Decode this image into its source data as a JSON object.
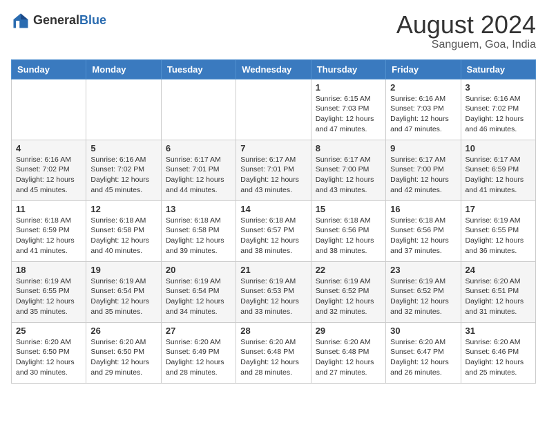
{
  "header": {
    "logo_general": "General",
    "logo_blue": "Blue",
    "month": "August 2024",
    "location": "Sanguem, Goa, India"
  },
  "weekdays": [
    "Sunday",
    "Monday",
    "Tuesday",
    "Wednesday",
    "Thursday",
    "Friday",
    "Saturday"
  ],
  "weeks": [
    [
      {
        "day": "",
        "info": ""
      },
      {
        "day": "",
        "info": ""
      },
      {
        "day": "",
        "info": ""
      },
      {
        "day": "",
        "info": ""
      },
      {
        "day": "1",
        "info": "Sunrise: 6:15 AM\nSunset: 7:03 PM\nDaylight: 12 hours\nand 47 minutes."
      },
      {
        "day": "2",
        "info": "Sunrise: 6:16 AM\nSunset: 7:03 PM\nDaylight: 12 hours\nand 47 minutes."
      },
      {
        "day": "3",
        "info": "Sunrise: 6:16 AM\nSunset: 7:02 PM\nDaylight: 12 hours\nand 46 minutes."
      }
    ],
    [
      {
        "day": "4",
        "info": "Sunrise: 6:16 AM\nSunset: 7:02 PM\nDaylight: 12 hours\nand 45 minutes."
      },
      {
        "day": "5",
        "info": "Sunrise: 6:16 AM\nSunset: 7:02 PM\nDaylight: 12 hours\nand 45 minutes."
      },
      {
        "day": "6",
        "info": "Sunrise: 6:17 AM\nSunset: 7:01 PM\nDaylight: 12 hours\nand 44 minutes."
      },
      {
        "day": "7",
        "info": "Sunrise: 6:17 AM\nSunset: 7:01 PM\nDaylight: 12 hours\nand 43 minutes."
      },
      {
        "day": "8",
        "info": "Sunrise: 6:17 AM\nSunset: 7:00 PM\nDaylight: 12 hours\nand 43 minutes."
      },
      {
        "day": "9",
        "info": "Sunrise: 6:17 AM\nSunset: 7:00 PM\nDaylight: 12 hours\nand 42 minutes."
      },
      {
        "day": "10",
        "info": "Sunrise: 6:17 AM\nSunset: 6:59 PM\nDaylight: 12 hours\nand 41 minutes."
      }
    ],
    [
      {
        "day": "11",
        "info": "Sunrise: 6:18 AM\nSunset: 6:59 PM\nDaylight: 12 hours\nand 41 minutes."
      },
      {
        "day": "12",
        "info": "Sunrise: 6:18 AM\nSunset: 6:58 PM\nDaylight: 12 hours\nand 40 minutes."
      },
      {
        "day": "13",
        "info": "Sunrise: 6:18 AM\nSunset: 6:58 PM\nDaylight: 12 hours\nand 39 minutes."
      },
      {
        "day": "14",
        "info": "Sunrise: 6:18 AM\nSunset: 6:57 PM\nDaylight: 12 hours\nand 38 minutes."
      },
      {
        "day": "15",
        "info": "Sunrise: 6:18 AM\nSunset: 6:56 PM\nDaylight: 12 hours\nand 38 minutes."
      },
      {
        "day": "16",
        "info": "Sunrise: 6:18 AM\nSunset: 6:56 PM\nDaylight: 12 hours\nand 37 minutes."
      },
      {
        "day": "17",
        "info": "Sunrise: 6:19 AM\nSunset: 6:55 PM\nDaylight: 12 hours\nand 36 minutes."
      }
    ],
    [
      {
        "day": "18",
        "info": "Sunrise: 6:19 AM\nSunset: 6:55 PM\nDaylight: 12 hours\nand 35 minutes."
      },
      {
        "day": "19",
        "info": "Sunrise: 6:19 AM\nSunset: 6:54 PM\nDaylight: 12 hours\nand 35 minutes."
      },
      {
        "day": "20",
        "info": "Sunrise: 6:19 AM\nSunset: 6:54 PM\nDaylight: 12 hours\nand 34 minutes."
      },
      {
        "day": "21",
        "info": "Sunrise: 6:19 AM\nSunset: 6:53 PM\nDaylight: 12 hours\nand 33 minutes."
      },
      {
        "day": "22",
        "info": "Sunrise: 6:19 AM\nSunset: 6:52 PM\nDaylight: 12 hours\nand 32 minutes."
      },
      {
        "day": "23",
        "info": "Sunrise: 6:19 AM\nSunset: 6:52 PM\nDaylight: 12 hours\nand 32 minutes."
      },
      {
        "day": "24",
        "info": "Sunrise: 6:20 AM\nSunset: 6:51 PM\nDaylight: 12 hours\nand 31 minutes."
      }
    ],
    [
      {
        "day": "25",
        "info": "Sunrise: 6:20 AM\nSunset: 6:50 PM\nDaylight: 12 hours\nand 30 minutes."
      },
      {
        "day": "26",
        "info": "Sunrise: 6:20 AM\nSunset: 6:50 PM\nDaylight: 12 hours\nand 29 minutes."
      },
      {
        "day": "27",
        "info": "Sunrise: 6:20 AM\nSunset: 6:49 PM\nDaylight: 12 hours\nand 28 minutes."
      },
      {
        "day": "28",
        "info": "Sunrise: 6:20 AM\nSunset: 6:48 PM\nDaylight: 12 hours\nand 28 minutes."
      },
      {
        "day": "29",
        "info": "Sunrise: 6:20 AM\nSunset: 6:48 PM\nDaylight: 12 hours\nand 27 minutes."
      },
      {
        "day": "30",
        "info": "Sunrise: 6:20 AM\nSunset: 6:47 PM\nDaylight: 12 hours\nand 26 minutes."
      },
      {
        "day": "31",
        "info": "Sunrise: 6:20 AM\nSunset: 6:46 PM\nDaylight: 12 hours\nand 25 minutes."
      }
    ]
  ]
}
